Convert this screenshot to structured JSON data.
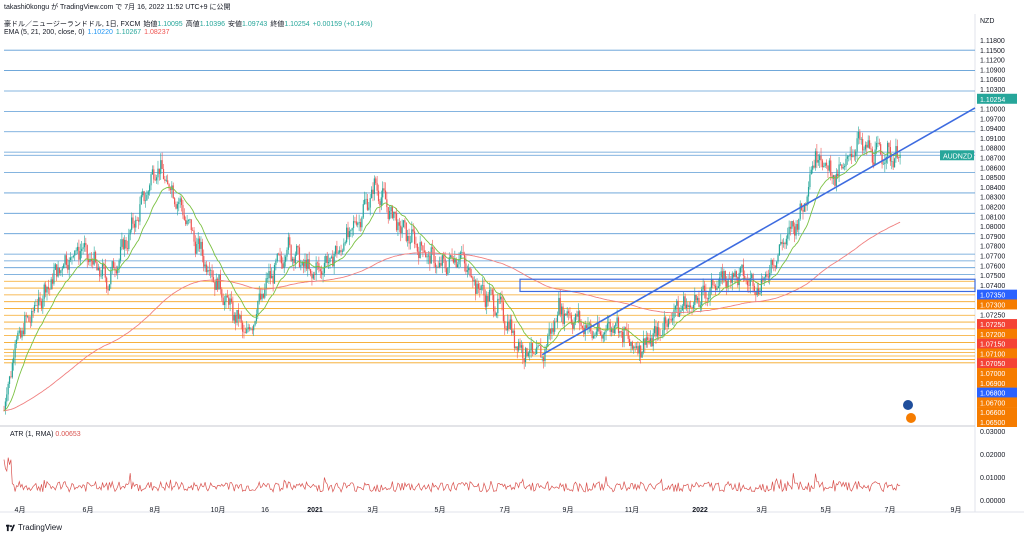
{
  "header": {
    "publish_line": "takashi0kongu が TradingView.com で 7月 16, 2022 11:52 UTC+9 に公開",
    "symbol_line": {
      "symbol": "豪ドル／ニュージーランドドル, 1日, FXCM",
      "open_label": "始値",
      "open_value": "1.10095",
      "high_label": "高値",
      "high_value": "1.10396",
      "low_label": "安値",
      "low_value": "1.09743",
      "close_label": "終値",
      "close_value": "1.10254",
      "change": "+0.00159 (+0.14%)"
    },
    "ema_line": {
      "label": "EMA (5, 21, 200, close, 0)",
      "v1": "1.10220",
      "v2": "1.10267",
      "v3": "1.08237"
    }
  },
  "colors": {
    "up": "#26a69a",
    "down": "#ef5350",
    "blue_line": "#5b9bd5",
    "orange_line": "#f5a623",
    "trend": "#3d6be0",
    "ema5": "#26a69a",
    "ema21": "#7bc142",
    "ema200": "#f08080",
    "atr": "#d9534f",
    "red_label": "#f44336",
    "blue_label": "#2962ff",
    "orange_label": "#f57c00"
  },
  "chart_data": [
    {
      "type": "line",
      "title": "豪ドル／ニュージーランドドル, 1日, FXCM",
      "currency": "NZD",
      "ylim": [
        1.063,
        1.1195
      ],
      "x_tick_labels": [
        "4月",
        "6月",
        "8月",
        "10月",
        "16",
        "2021",
        "3月",
        "5月",
        "7月",
        "9月",
        "11月",
        "2022",
        "3月",
        "5月",
        "7月",
        "9月"
      ],
      "series": [
        {
          "name": "AUDNZD",
          "last": 1.10254
        },
        {
          "name": "EMA 5",
          "last": 1.1022
        },
        {
          "name": "EMA 21",
          "last": 1.10267
        },
        {
          "name": "EMA 200",
          "last": 1.08237
        }
      ],
      "horizontal_levels_blue": [
        1.118,
        1.115,
        1.112,
        1.109,
        1.106,
        1.103,
        1.10254,
        1.1,
        1.097,
        1.094,
        1.091,
        1.088,
        1.087,
        1.086,
        1.085
      ],
      "horizontal_levels_orange": [
        1.084,
        1.083,
        1.082,
        1.081,
        1.08,
        1.079,
        1.078,
        1.077,
        1.076,
        1.075,
        1.074,
        1.0735,
        1.073,
        1.0725,
        1.072
      ],
      "price_labels": [
        {
          "text": "1.11800",
          "style": "plain"
        },
        {
          "text": "1.11500",
          "style": "plain"
        },
        {
          "text": "1.11200",
          "style": "plain"
        },
        {
          "text": "1.10900",
          "style": "plain"
        },
        {
          "text": "1.10600",
          "style": "plain"
        },
        {
          "text": "1.10300",
          "style": "plain"
        },
        {
          "text": "1.10254",
          "style": "green"
        },
        {
          "text": "1.10000",
          "style": "plain"
        },
        {
          "text": "1.09700",
          "style": "plain"
        },
        {
          "text": "1.09400",
          "style": "plain"
        },
        {
          "text": "1.09100",
          "style": "plain"
        },
        {
          "text": "1.08800",
          "style": "plain"
        },
        {
          "text": "1.08700",
          "style": "plain"
        },
        {
          "text": "1.08600",
          "style": "plain"
        },
        {
          "text": "1.08500",
          "style": "plain"
        },
        {
          "text": "1.08400",
          "style": "plain"
        },
        {
          "text": "1.08300",
          "style": "plain"
        },
        {
          "text": "1.08200",
          "style": "plain"
        },
        {
          "text": "1.08100",
          "style": "plain"
        },
        {
          "text": "1.08000",
          "style": "plain"
        },
        {
          "text": "1.07900",
          "style": "plain"
        },
        {
          "text": "1.07800",
          "style": "plain"
        },
        {
          "text": "1.07700",
          "style": "plain"
        },
        {
          "text": "1.07600",
          "style": "plain"
        },
        {
          "text": "1.07500",
          "style": "plain"
        },
        {
          "text": "1.07400",
          "style": "plain"
        },
        {
          "text": "1.07350",
          "style": "blue"
        },
        {
          "text": "1.07300",
          "style": "orange"
        },
        {
          "text": "1.07250",
          "style": "plain"
        },
        {
          "text": "1.07250",
          "style": "red"
        },
        {
          "text": "1.07200",
          "style": "orange"
        },
        {
          "text": "1.07150",
          "style": "red"
        },
        {
          "text": "1.07100",
          "style": "orange"
        },
        {
          "text": "1.07050",
          "style": "red"
        },
        {
          "text": "1.07000",
          "style": "orange"
        },
        {
          "text": "1.06900",
          "style": "orange"
        },
        {
          "text": "1.06800",
          "style": "blue"
        },
        {
          "text": "1.06700",
          "style": "orange"
        },
        {
          "text": "1.06600",
          "style": "orange"
        },
        {
          "text": "1.06500",
          "style": "orange"
        }
      ],
      "symbol_tag": "AUDNZD",
      "price_anchors": [
        [
          0,
          1.065
        ],
        [
          8,
          1.075
        ],
        [
          25,
          1.081
        ],
        [
          40,
          1.086
        ],
        [
          55,
          1.089
        ],
        [
          75,
          1.084
        ],
        [
          95,
          1.093
        ],
        [
          110,
          1.101
        ],
        [
          125,
          1.096
        ],
        [
          140,
          1.089
        ],
        [
          158,
          1.082
        ],
        [
          175,
          1.076
        ],
        [
          190,
          1.084
        ],
        [
          205,
          1.089
        ],
        [
          222,
          1.085
        ],
        [
          240,
          1.088
        ],
        [
          255,
          1.093
        ],
        [
          268,
          1.098
        ],
        [
          285,
          1.092
        ],
        [
          300,
          1.089
        ],
        [
          315,
          1.086
        ],
        [
          328,
          1.088
        ],
        [
          342,
          1.083
        ],
        [
          358,
          1.08
        ],
        [
          372,
          1.074
        ],
        [
          388,
          1.073
        ],
        [
          400,
          1.08
        ],
        [
          415,
          1.078
        ],
        [
          428,
          1.076
        ],
        [
          440,
          1.078
        ],
        [
          455,
          1.074
        ],
        [
          470,
          1.076
        ],
        [
          485,
          1.08
        ],
        [
          500,
          1.081
        ],
        [
          515,
          1.084
        ],
        [
          530,
          1.085
        ],
        [
          545,
          1.083
        ],
        [
          560,
          1.089
        ],
        [
          575,
          1.094
        ],
        [
          585,
          1.103
        ],
        [
          600,
          1.099
        ],
        [
          615,
          1.1045
        ],
        [
          625,
          1.103
        ],
        [
          640,
          1.1025
        ],
        [
          646,
          1.1025
        ]
      ]
    },
    {
      "type": "line",
      "title": "ATR (1, RMA)",
      "last": 0.00653,
      "ylim": [
        0,
        0.0305
      ],
      "y_tick_labels": [
        "0.03000",
        "0.02000",
        "0.01000",
        "0.00000"
      ]
    }
  ],
  "footer": {
    "brand": "TradingView"
  }
}
